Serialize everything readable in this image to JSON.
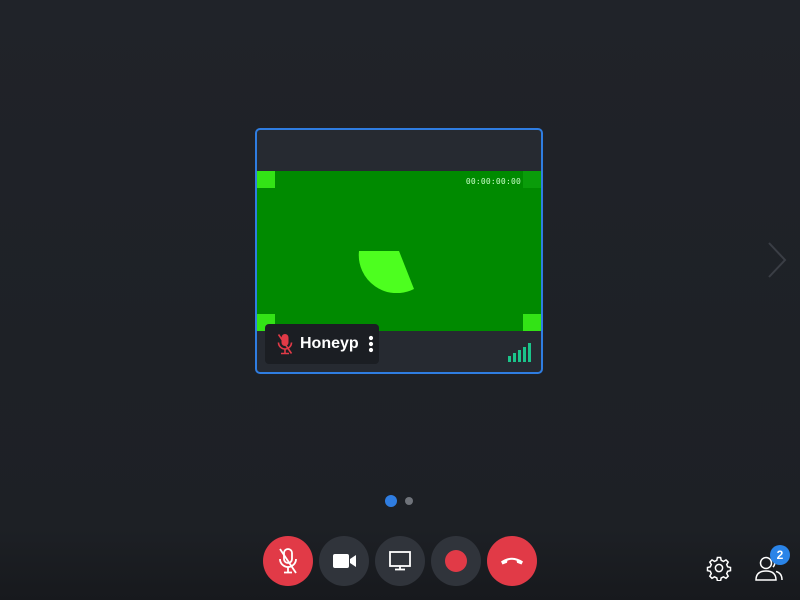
{
  "tile": {
    "participant_name": "Honeyp",
    "microphone_muted": true,
    "timecode": "00:00:00:00",
    "connection_quality_bars": 5
  },
  "pagination": {
    "current_page": 1,
    "total_pages": 2
  },
  "toolbar": {
    "buttons": [
      {
        "name": "microphone",
        "state": "muted",
        "color": "#e13a47"
      },
      {
        "name": "camera",
        "state": "on",
        "color": "#30343b"
      },
      {
        "name": "screen-share",
        "state": "off",
        "color": "#30343b"
      },
      {
        "name": "record",
        "state": "off",
        "color": "#30343b"
      },
      {
        "name": "hang-up",
        "state": "active",
        "color": "#e13a47"
      }
    ]
  },
  "participants": {
    "count": "2"
  },
  "colors": {
    "accent": "#2f7de1",
    "danger": "#e13a47",
    "video_background": "#008a00",
    "signal": "#1bc48a"
  }
}
